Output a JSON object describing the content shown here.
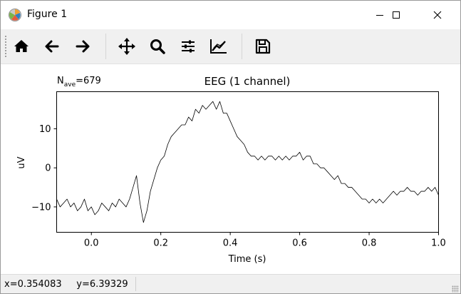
{
  "window": {
    "title": "Figure 1",
    "minimize_icon": "minimize-icon",
    "maximize_icon": "maximize-icon",
    "close_icon": "close-icon"
  },
  "toolbar": {
    "buttons": [
      {
        "name": "home-button",
        "icon": "home-icon"
      },
      {
        "name": "back-button",
        "icon": "arrow-left-icon"
      },
      {
        "name": "forward-button",
        "icon": "arrow-right-icon"
      },
      {
        "name": "pan-button",
        "icon": "move-icon"
      },
      {
        "name": "zoom-button",
        "icon": "magnifier-icon"
      },
      {
        "name": "subplots-button",
        "icon": "sliders-icon"
      },
      {
        "name": "edit-axes-button",
        "icon": "line-chart-icon"
      },
      {
        "name": "save-button",
        "icon": "floppy-disk-icon"
      }
    ]
  },
  "status": {
    "coords": "x=0.354083     y=6.39329"
  },
  "chart_data": {
    "type": "line",
    "title": "EEG (1 channel)",
    "annotation": {
      "main": "N",
      "subscript": "ave",
      "suffix": "=679"
    },
    "xlabel": "Time (s)",
    "ylabel": "uV",
    "xlim": [
      -0.1,
      1.0
    ],
    "ylim": [
      -16.5,
      19.5
    ],
    "xticks": [
      0.0,
      0.2,
      0.4,
      0.6,
      0.8,
      1.0
    ],
    "xtick_labels": [
      "0.0",
      "0.2",
      "0.4",
      "0.6",
      "0.8",
      "1.0"
    ],
    "yticks": [
      -10,
      0,
      10
    ],
    "ytick_labels": [
      "−10",
      "0",
      "10"
    ],
    "line_color": "#000000",
    "grid": false,
    "series": [
      {
        "x": [
          -0.1,
          -0.09,
          -0.08,
          -0.07,
          -0.06,
          -0.05,
          -0.04,
          -0.03,
          -0.02,
          -0.01,
          0.0,
          0.01,
          0.02,
          0.03,
          0.04,
          0.05,
          0.06,
          0.07,
          0.08,
          0.09,
          0.1,
          0.11,
          0.12,
          0.13,
          0.14,
          0.15,
          0.16,
          0.17,
          0.18,
          0.19,
          0.2,
          0.21,
          0.22,
          0.23,
          0.24,
          0.25,
          0.26,
          0.27,
          0.28,
          0.29,
          0.3,
          0.31,
          0.32,
          0.33,
          0.34,
          0.35,
          0.36,
          0.37,
          0.38,
          0.39,
          0.4,
          0.41,
          0.42,
          0.43,
          0.44,
          0.45,
          0.46,
          0.47,
          0.48,
          0.49,
          0.5,
          0.51,
          0.52,
          0.53,
          0.54,
          0.55,
          0.56,
          0.57,
          0.58,
          0.59,
          0.6,
          0.61,
          0.62,
          0.63,
          0.64,
          0.65,
          0.66,
          0.67,
          0.68,
          0.69,
          0.7,
          0.71,
          0.72,
          0.73,
          0.74,
          0.75,
          0.76,
          0.77,
          0.78,
          0.79,
          0.8,
          0.81,
          0.82,
          0.83,
          0.84,
          0.85,
          0.86,
          0.87,
          0.88,
          0.89,
          0.9,
          0.91,
          0.92,
          0.93,
          0.94,
          0.95,
          0.96,
          0.97,
          0.98,
          0.99,
          1.0
        ],
        "y": [
          -8,
          -10,
          -9,
          -8,
          -10,
          -9,
          -11,
          -10,
          -8,
          -11,
          -10,
          -12,
          -11,
          -9,
          -10,
          -11,
          -9,
          -10,
          -8,
          -9,
          -10,
          -8,
          -5,
          -2,
          -9,
          -14,
          -11,
          -6,
          -3,
          0,
          2,
          3,
          6,
          8,
          9,
          10,
          11,
          11,
          13,
          12,
          15,
          14,
          16,
          15,
          16,
          17,
          15,
          17,
          14,
          14,
          12,
          10,
          8,
          7,
          6,
          4,
          3,
          3,
          2,
          3,
          2,
          3,
          3,
          2,
          3,
          2,
          3,
          2,
          3,
          3,
          4,
          2,
          3,
          3,
          1,
          1,
          0,
          0,
          -1,
          -2,
          -3,
          -2,
          -4,
          -4,
          -5,
          -5,
          -6,
          -7,
          -8,
          -8,
          -9,
          -8,
          -9,
          -8,
          -9,
          -8,
          -7,
          -6,
          -7,
          -6,
          -6,
          -5,
          -6,
          -6,
          -7,
          -6,
          -6,
          -5,
          -6,
          -5,
          -7
        ]
      }
    ]
  }
}
